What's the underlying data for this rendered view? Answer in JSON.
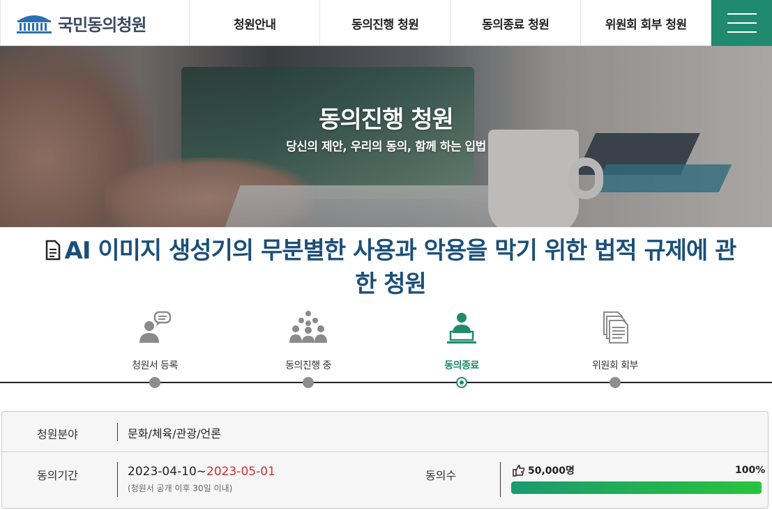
{
  "header": {
    "logo_text": "국민동의청원",
    "nav": [
      "청원안내",
      "동의진행 청원",
      "동의종료 청원",
      "위원회 회부 청원"
    ],
    "menu_icon": "hamburger-icon",
    "accent_color": "#1f8a6e"
  },
  "hero": {
    "title": "동의진행 청원",
    "subtitle": "당신의 제안, 우리의 동의, 함께 하는 입법"
  },
  "petition": {
    "title": "AI 이미지 생성기의 무분별한 사용과 악용을 막기 위한 법적 규제에 관한 청원",
    "title_color": "#1b4f7a"
  },
  "steps": [
    {
      "label": "청원서 등록",
      "icon": "speech-person-icon",
      "active": false
    },
    {
      "label": "동의진행 중",
      "icon": "group-icon",
      "active": false
    },
    {
      "label": "동의종료",
      "icon": "presenter-icon",
      "active": true
    },
    {
      "label": "위원회 회부",
      "icon": "documents-icon",
      "active": false
    }
  ],
  "info": {
    "field_label": "청원분야",
    "field_value": "문화/체육/관광/언론",
    "period_label": "동의기간",
    "period_start": "2023-04-10~",
    "period_end": "2023-05-01",
    "period_note": "(청원서 공개 이후 30일 이내)",
    "agree_label": "동의수",
    "agree_count": "50,000명",
    "agree_percent_text": "100%",
    "agree_fraction": 1.0
  }
}
